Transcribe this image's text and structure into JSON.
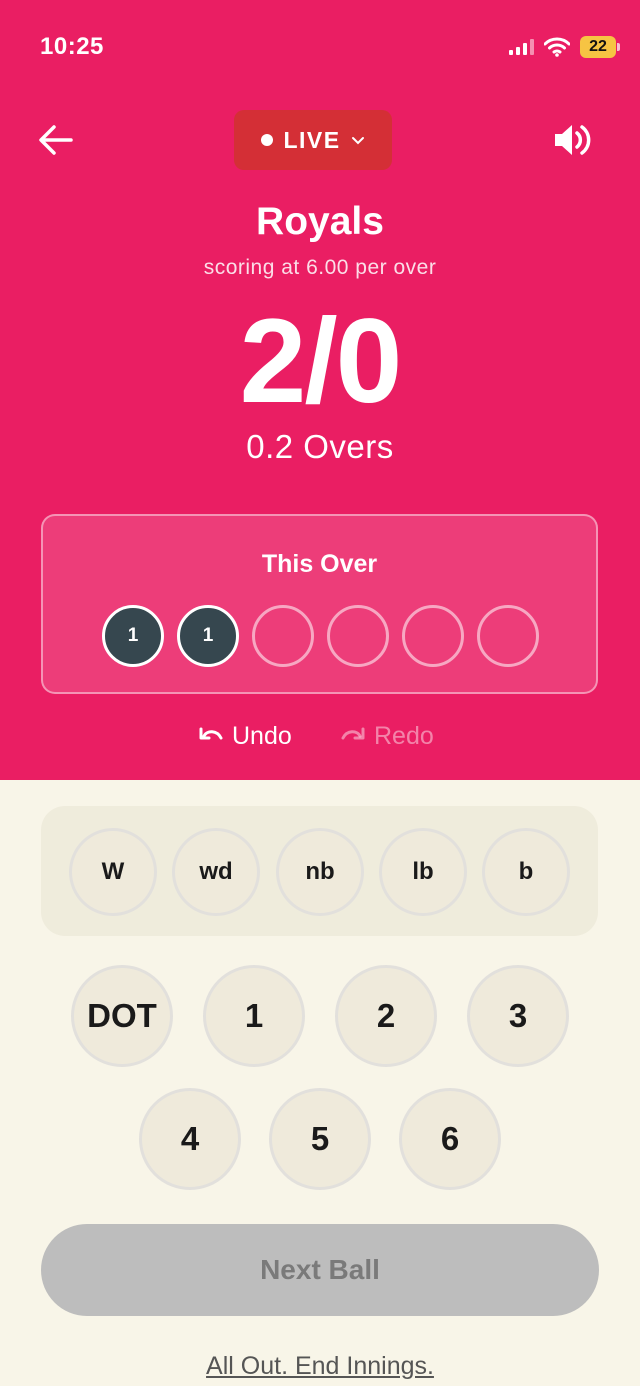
{
  "status_bar": {
    "time": "10:25",
    "battery": "22"
  },
  "header": {
    "live_label": "LIVE"
  },
  "innings": {
    "team": "Royals",
    "rate": "scoring at 6.00 per over",
    "score": "2/0",
    "overs": "0.2 Overs"
  },
  "this_over": {
    "title": "This Over",
    "balls": [
      "1",
      "1",
      "",
      "",
      "",
      ""
    ]
  },
  "history": {
    "undo_label": "Undo",
    "redo_label": "Redo"
  },
  "extras": [
    "W",
    "wd",
    "nb",
    "lb",
    "b"
  ],
  "runs": [
    "DOT",
    "1",
    "2",
    "3",
    "4",
    "5",
    "6"
  ],
  "actions": {
    "next_ball_label": "Next Ball",
    "end_innings_label": "All Out. End Innings."
  },
  "colors": {
    "header_bg": "#ea1e63",
    "live_bg": "#d42f36",
    "ball_filled": "#36474f",
    "panel_bg": "#f8f5e8"
  },
  "icons": [
    "back-arrow-icon",
    "chevron-down-icon",
    "speaker-icon",
    "undo-icon",
    "redo-icon",
    "wifi-icon",
    "signal-icon",
    "battery-icon"
  ]
}
